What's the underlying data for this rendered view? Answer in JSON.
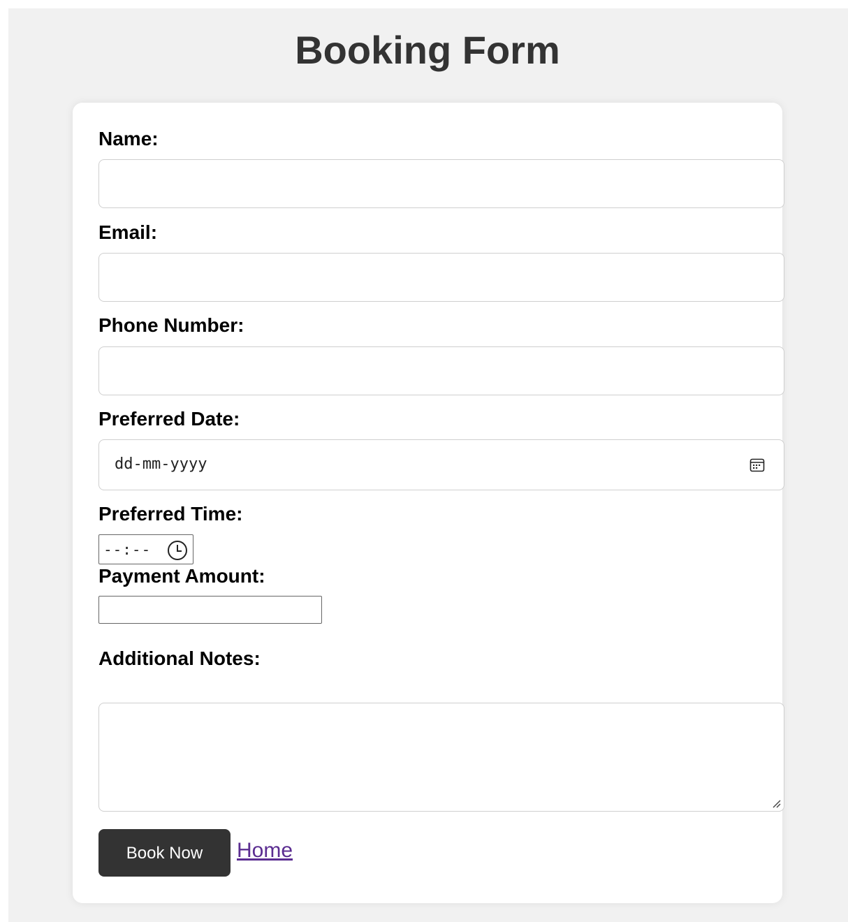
{
  "page": {
    "title": "Booking Form"
  },
  "form": {
    "name_label": "Name:",
    "name_value": "",
    "email_label": "Email:",
    "email_value": "",
    "phone_label": "Phone Number:",
    "phone_value": "",
    "date_label": "Preferred Date:",
    "date_placeholder": "dd-mm-yyyy",
    "time_label": "Preferred Time:",
    "time_placeholder": "--:--",
    "amount_label": "Payment Amount:",
    "amount_value": "",
    "notes_label": "Additional Notes:",
    "notes_value": "",
    "submit_label": "Book Now",
    "home_link_label": "Home"
  },
  "icons": {
    "date_icon": "calendar-icon",
    "time_icon": "clock-icon",
    "notes_resize": "resize-grip-icon"
  },
  "colors": {
    "page_background": "#f1f1f1",
    "card_background": "#ffffff",
    "title_color": "#333333",
    "button_background": "#333333",
    "button_text": "#ffffff",
    "link_color": "#5b2d91"
  }
}
